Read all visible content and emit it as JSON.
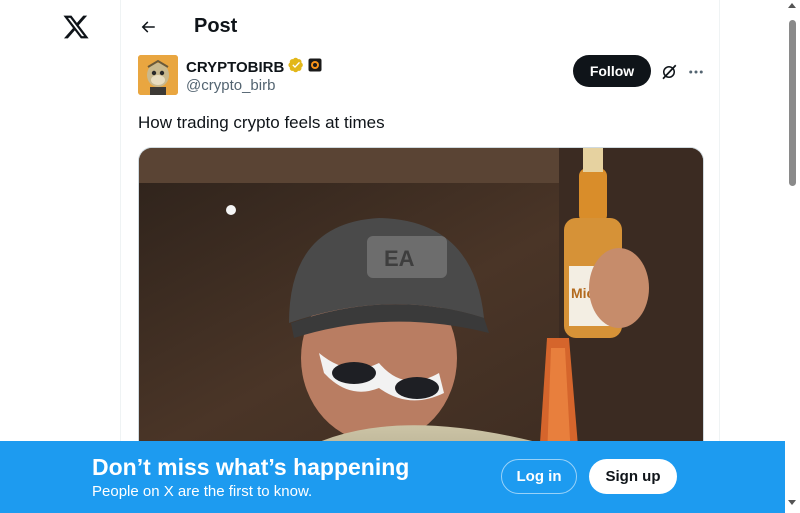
{
  "header": {
    "title": "Post",
    "back_icon": "arrow-left-icon"
  },
  "logo": {
    "icon": "x-logo-icon"
  },
  "post": {
    "author": {
      "display_name": "CRYPTOBIRB",
      "handle": "@crypto_birb",
      "verified_icon": "gold-checkmark-badge-icon",
      "affiliate_icon": "affiliate-badge-icon"
    },
    "follow_label": "Follow",
    "grok_icon": "grok-icon",
    "more_icon": "more-dots-icon",
    "text": "How trading crypto feels at times",
    "media_type": "video"
  },
  "bottom_bar": {
    "title": "Don’t miss what’s happening",
    "subtitle": "People on X are the first to know.",
    "login_label": "Log in",
    "signup_label": "Sign up"
  },
  "colors": {
    "accent": "#1d9bf0",
    "text": "#0f1419",
    "muted": "#536471",
    "verified_gold": "#e2b719"
  }
}
